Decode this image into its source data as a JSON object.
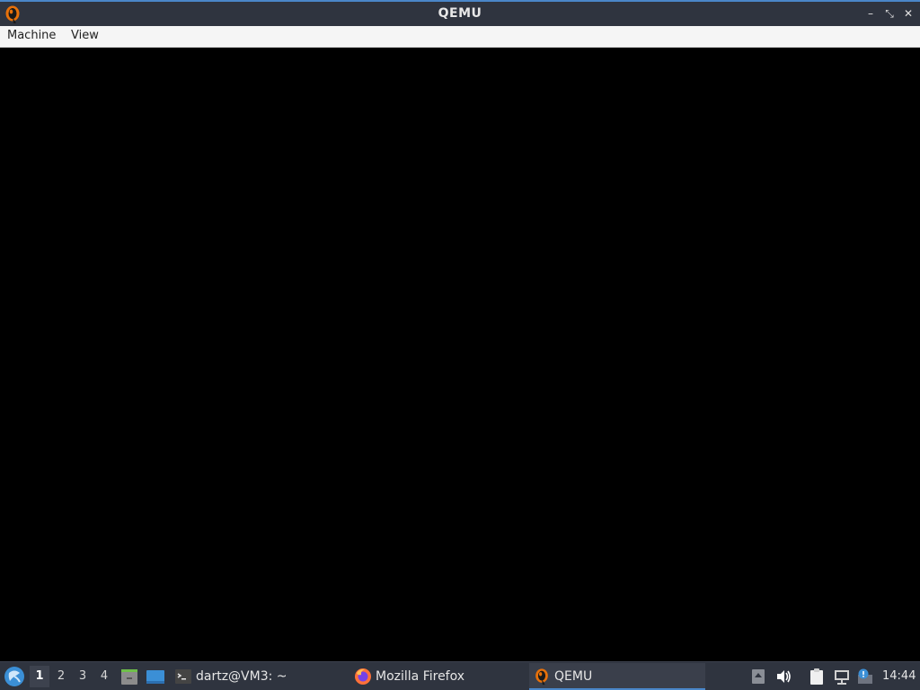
{
  "window": {
    "title": "QEMU",
    "icon": "qemu-icon",
    "controls": {
      "minimize_glyph": "–",
      "maximize_glyph": "⤡",
      "close_glyph": "✕"
    }
  },
  "menubar": {
    "items": [
      {
        "label": "Machine"
      },
      {
        "label": "View"
      }
    ]
  },
  "display": {
    "background": "#000000"
  },
  "taskbar": {
    "start_icon": "lxqt-start-icon",
    "workspaces": [
      {
        "label": "1",
        "active": true
      },
      {
        "label": "2",
        "active": false
      },
      {
        "label": "3",
        "active": false
      },
      {
        "label": "4",
        "active": false
      }
    ],
    "quick_launch": [
      {
        "icon": "file-manager-icon"
      },
      {
        "icon": "show-desktop-icon"
      }
    ],
    "tasks": [
      {
        "label": "dartz@VM3: ~",
        "icon": "terminal-icon",
        "active": false
      },
      {
        "label": "Mozilla Firefox",
        "icon": "firefox-icon",
        "active": false
      },
      {
        "label": "QEMU",
        "icon": "qemu-icon",
        "active": true
      }
    ],
    "tray": [
      {
        "icon": "tray-arrow-icon"
      },
      {
        "icon": "volume-icon"
      },
      {
        "icon": "clipboard-icon"
      },
      {
        "icon": "network-icon"
      },
      {
        "icon": "notification-icon"
      }
    ],
    "clock": "14:44"
  },
  "colors": {
    "titlebar_bg": "#2f343f",
    "accent": "#4a86c8",
    "menubar_bg": "#f5f5f5",
    "taskbar_bg": "#2f343f"
  }
}
